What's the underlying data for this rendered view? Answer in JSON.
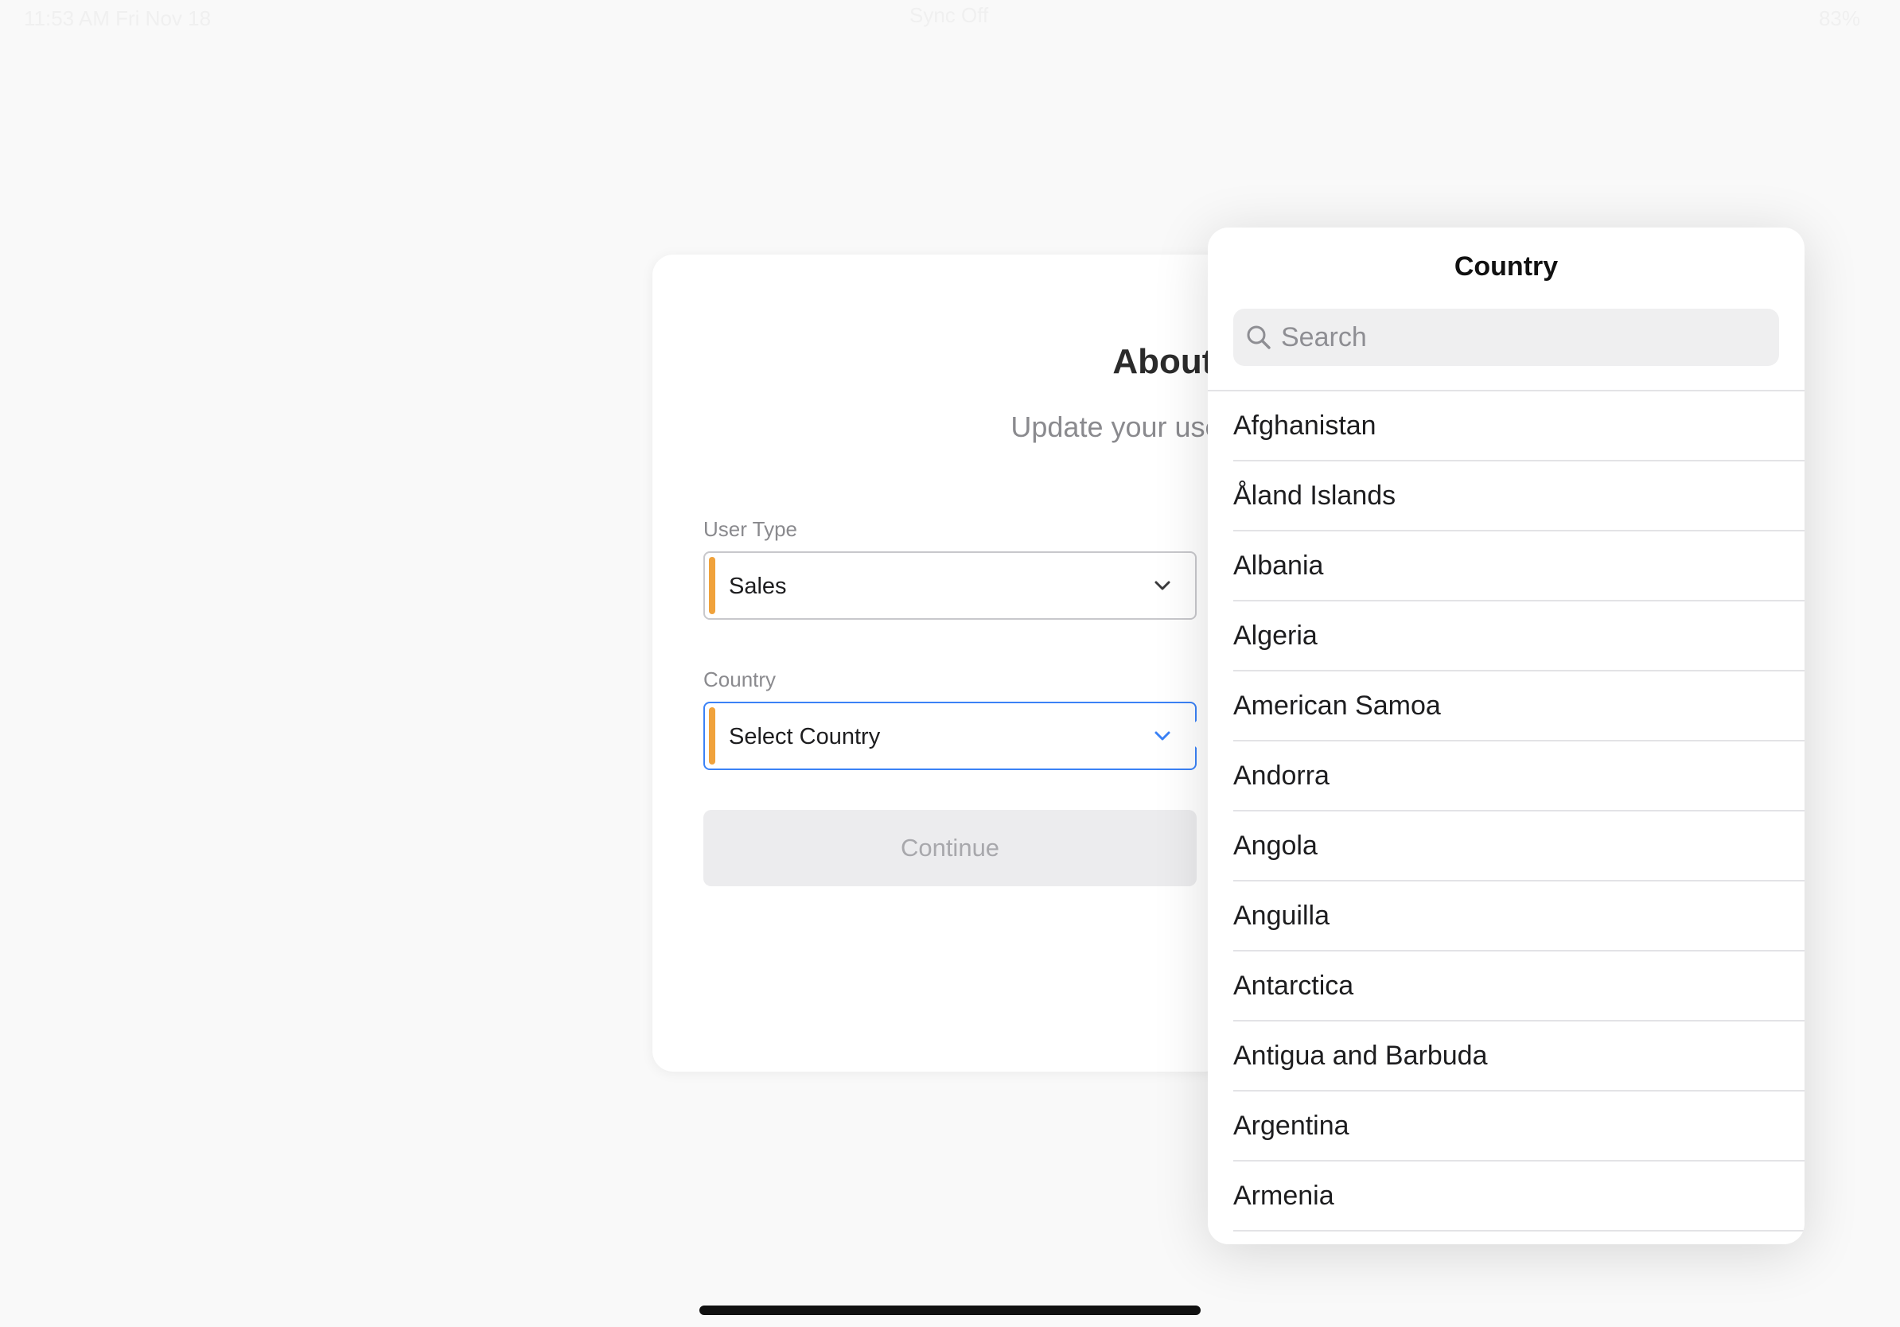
{
  "status_bar": {
    "time_date": "11:53 AM   Fri Nov 18",
    "center": "Sync Off",
    "battery": "83%"
  },
  "card": {
    "title": "About You",
    "subtitle": "Update your user information.",
    "user_type": {
      "label": "User Type",
      "value": "Sales"
    },
    "country": {
      "label": "Country",
      "value": "Select Country"
    },
    "continue_label": "Continue"
  },
  "popover": {
    "title": "Country",
    "search_placeholder": "Search",
    "items": [
      "Afghanistan",
      "Åland Islands",
      "Albania",
      "Algeria",
      "American Samoa",
      "Andorra",
      "Angola",
      "Anguilla",
      "Antarctica",
      "Antigua and Barbuda",
      "Argentina",
      "Armenia"
    ]
  },
  "colors": {
    "accent": "#f0a23b",
    "focus": "#3b82f6"
  }
}
